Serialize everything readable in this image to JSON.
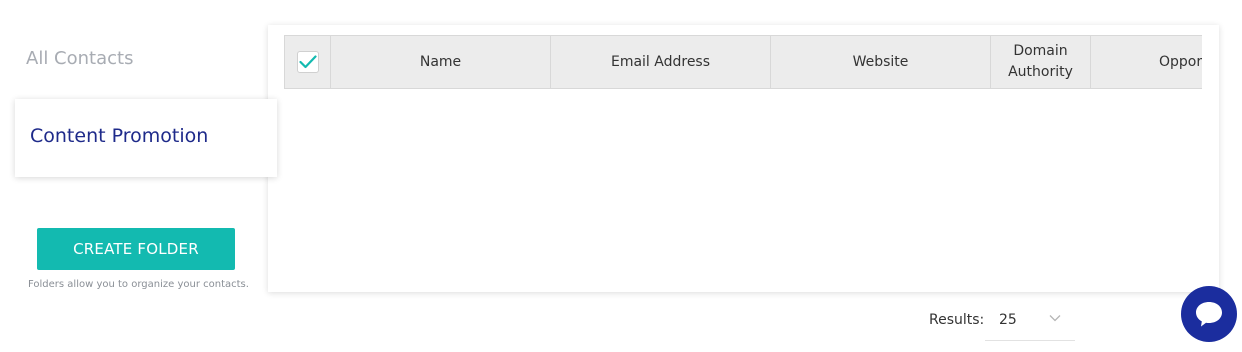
{
  "sidebar": {
    "all_contacts_label": "All Contacts",
    "folders": [
      {
        "label": "Content Promotion"
      }
    ],
    "create_folder_label": "CREATE FOLDER",
    "folder_hint": "Folders allow you to organize your contacts."
  },
  "table": {
    "select_all_checked": true,
    "columns": [
      {
        "key": "name",
        "label": "Name"
      },
      {
        "key": "email",
        "label": "Email Address"
      },
      {
        "key": "website",
        "label": "Website"
      },
      {
        "key": "domain_authority",
        "label": "Domain Authority"
      },
      {
        "key": "opportunity",
        "label": "Oppor"
      }
    ],
    "rows": []
  },
  "pagination": {
    "results_label": "Results:",
    "page_size": "25"
  },
  "colors": {
    "accent": "#13bab0",
    "brand": "#1b2d9e",
    "active_folder_text": "#1e2a8a",
    "header_bg": "#ececec"
  },
  "icons": {
    "checkbox": "check-icon",
    "dropdown": "chevron-down-icon",
    "chat": "chat-bubble-icon"
  }
}
